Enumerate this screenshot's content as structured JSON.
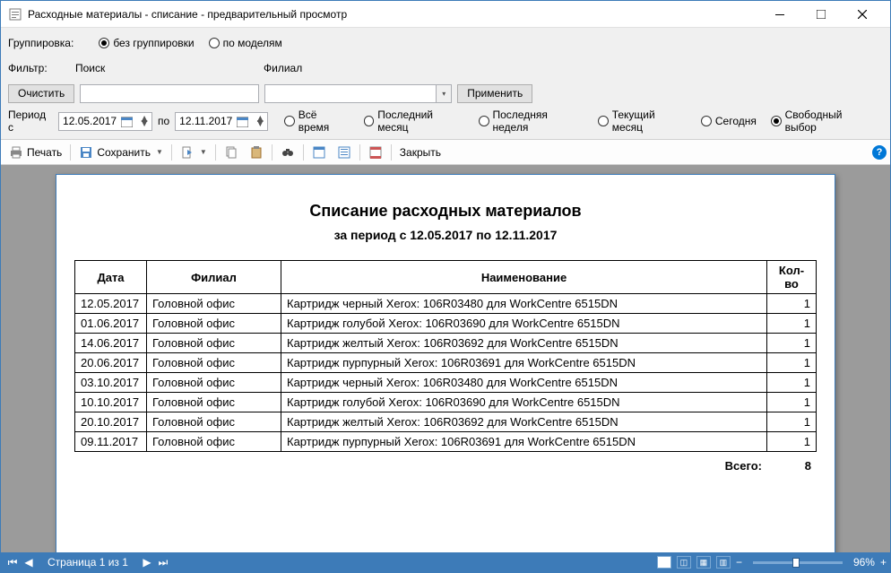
{
  "window": {
    "title": "Расходные материалы - списание - предварительный просмотр"
  },
  "filters": {
    "group_label": "Группировка:",
    "group_none": "без группировки",
    "group_model": "по моделям",
    "filter_label": "Фильтр:",
    "search_label": "Поиск",
    "branch_label": "Филиал",
    "clear_btn": "Очистить",
    "apply_btn": "Применить",
    "period_label": "Период с",
    "period_to": "по",
    "date_from": "12.05.2017",
    "date_to": "12.11.2017",
    "p_all": "Всё время",
    "p_lastmonth": "Последний месяц",
    "p_lastweek": "Последняя неделя",
    "p_curmonth": "Текущий месяц",
    "p_today": "Сегодня",
    "p_free": "Свободный выбор"
  },
  "toolbar": {
    "print": "Печать",
    "save": "Сохранить",
    "close": "Закрыть"
  },
  "report": {
    "title": "Списание расходных материалов",
    "subtitle": "за период с 12.05.2017 по 12.11.2017",
    "col_date": "Дата",
    "col_branch": "Филиал",
    "col_name": "Наименование",
    "col_qty": "Кол-во",
    "rows": [
      {
        "date": "12.05.2017",
        "branch": "Головной офис",
        "name": "Картридж черный Xerox: 106R03480 для WorkCentre 6515DN",
        "qty": "1"
      },
      {
        "date": "01.06.2017",
        "branch": "Головной офис",
        "name": "Картридж голубой Xerox: 106R03690 для WorkCentre 6515DN",
        "qty": "1"
      },
      {
        "date": "14.06.2017",
        "branch": "Головной офис",
        "name": "Картридж желтый Xerox: 106R03692 для WorkCentre 6515DN",
        "qty": "1"
      },
      {
        "date": "20.06.2017",
        "branch": "Головной офис",
        "name": "Картридж пурпурный Xerox: 106R03691 для WorkCentre 6515DN",
        "qty": "1"
      },
      {
        "date": "03.10.2017",
        "branch": "Головной офис",
        "name": "Картридж черный Xerox: 106R03480 для WorkCentre 6515DN",
        "qty": "1"
      },
      {
        "date": "10.10.2017",
        "branch": "Головной офис",
        "name": "Картридж голубой Xerox: 106R03690 для WorkCentre 6515DN",
        "qty": "1"
      },
      {
        "date": "20.10.2017",
        "branch": "Головной офис",
        "name": "Картридж желтый Xerox: 106R03692 для WorkCentre 6515DN",
        "qty": "1"
      },
      {
        "date": "09.11.2017",
        "branch": "Головной офис",
        "name": "Картридж пурпурный Xerox: 106R03691 для WorkCentre 6515DN",
        "qty": "1"
      }
    ],
    "total_label": "Всего:",
    "total_value": "8"
  },
  "status": {
    "page_text": "Страница 1 из 1",
    "zoom": "96%"
  }
}
